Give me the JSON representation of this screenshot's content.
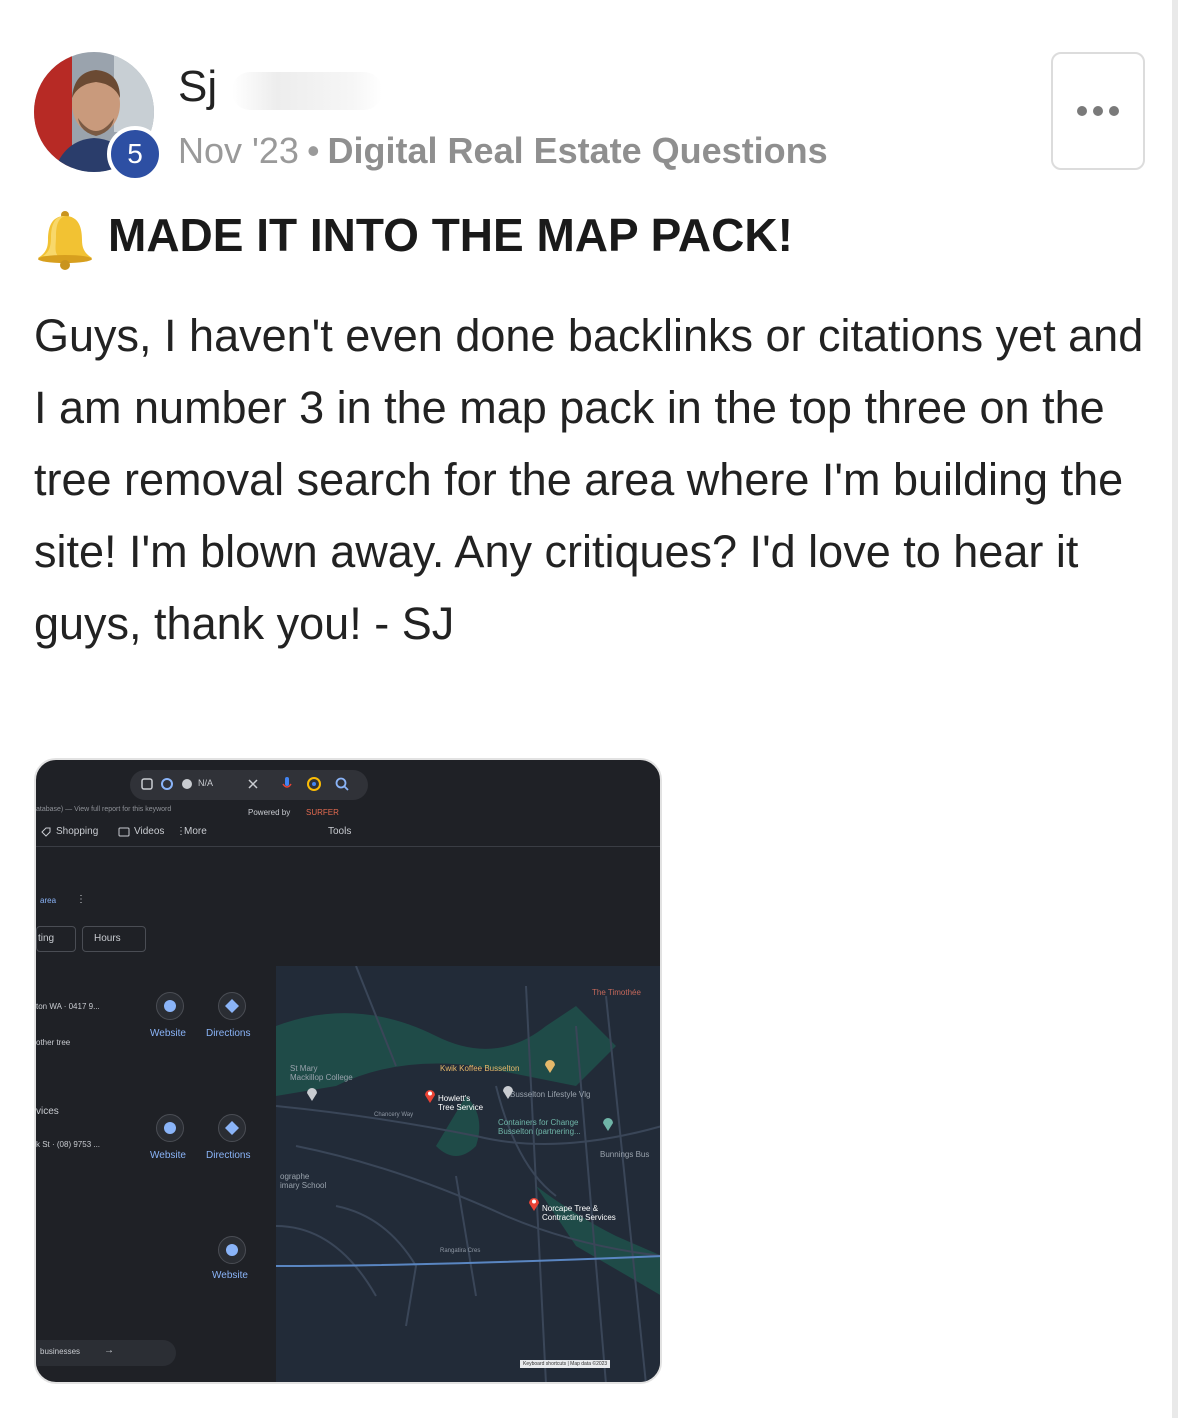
{
  "post": {
    "author": "Sj",
    "level": "5",
    "date": "Nov '23",
    "separator": "•",
    "category": "Digital Real Estate Questions",
    "title": "MADE IT INTO THE MAP PACK!",
    "body": "Guys, I haven't even done backlinks or citations yet and I am number 3 in the map pack in the top three on the tree removal search for the area where I'm building the site! I'm blown away. Any critiques? I'd love to hear it guys, thank you! - SJ"
  },
  "icons": {
    "more": "more-horizontal-icon",
    "bell": "bell-icon"
  },
  "colors": {
    "badge": "#2d4fa3",
    "meta": "#9a9a9a",
    "map_bg": "#222b38",
    "map_water": "#1f4b48",
    "pin": "#ea4335",
    "link": "#8ab4f8"
  },
  "screenshot": {
    "search_chip": "N/A",
    "view_report": "atabase) — View full report for this keyword",
    "powered_by": "Powered by",
    "surfer": "SURFER",
    "tab_shopping": "Shopping",
    "tab_videos": "Videos",
    "tab_more": "More",
    "tools": "Tools",
    "area_chip": "area",
    "filter_rating": "ting",
    "filter_hours": "Hours",
    "listing1_addr": "ton WA · 0417 9...",
    "listing1_desc": "other tree",
    "listing2_name": "vices",
    "listing2_addr": "k St · (08) 9753 ...",
    "website_label": "Website",
    "directions_label": "Directions",
    "more_businesses": "businesses",
    "map_labels": {
      "timothee": "The Timothée",
      "st_mary": "St Mary",
      "mackillop": "Mackillop College",
      "kwik": "Kwik Koffee Busselton",
      "howletts1": "Howlett's",
      "howletts2": "Tree Service",
      "lifestyle": "Busselton Lifestyle Vlg",
      "containers1": "Containers for Change",
      "containers2": "Busselton (partnering...",
      "bunnings": "Bunnings Bus",
      "norcape1": "Norcape Tree &",
      "norcape2": "Contracting Services",
      "geographe1": "ographe",
      "geographe2": "imary School",
      "chancery": "Chancery Way",
      "rangatira": "Rangatira Cres",
      "footer": "Keyboard shortcuts  |  Map data ©2023"
    }
  }
}
